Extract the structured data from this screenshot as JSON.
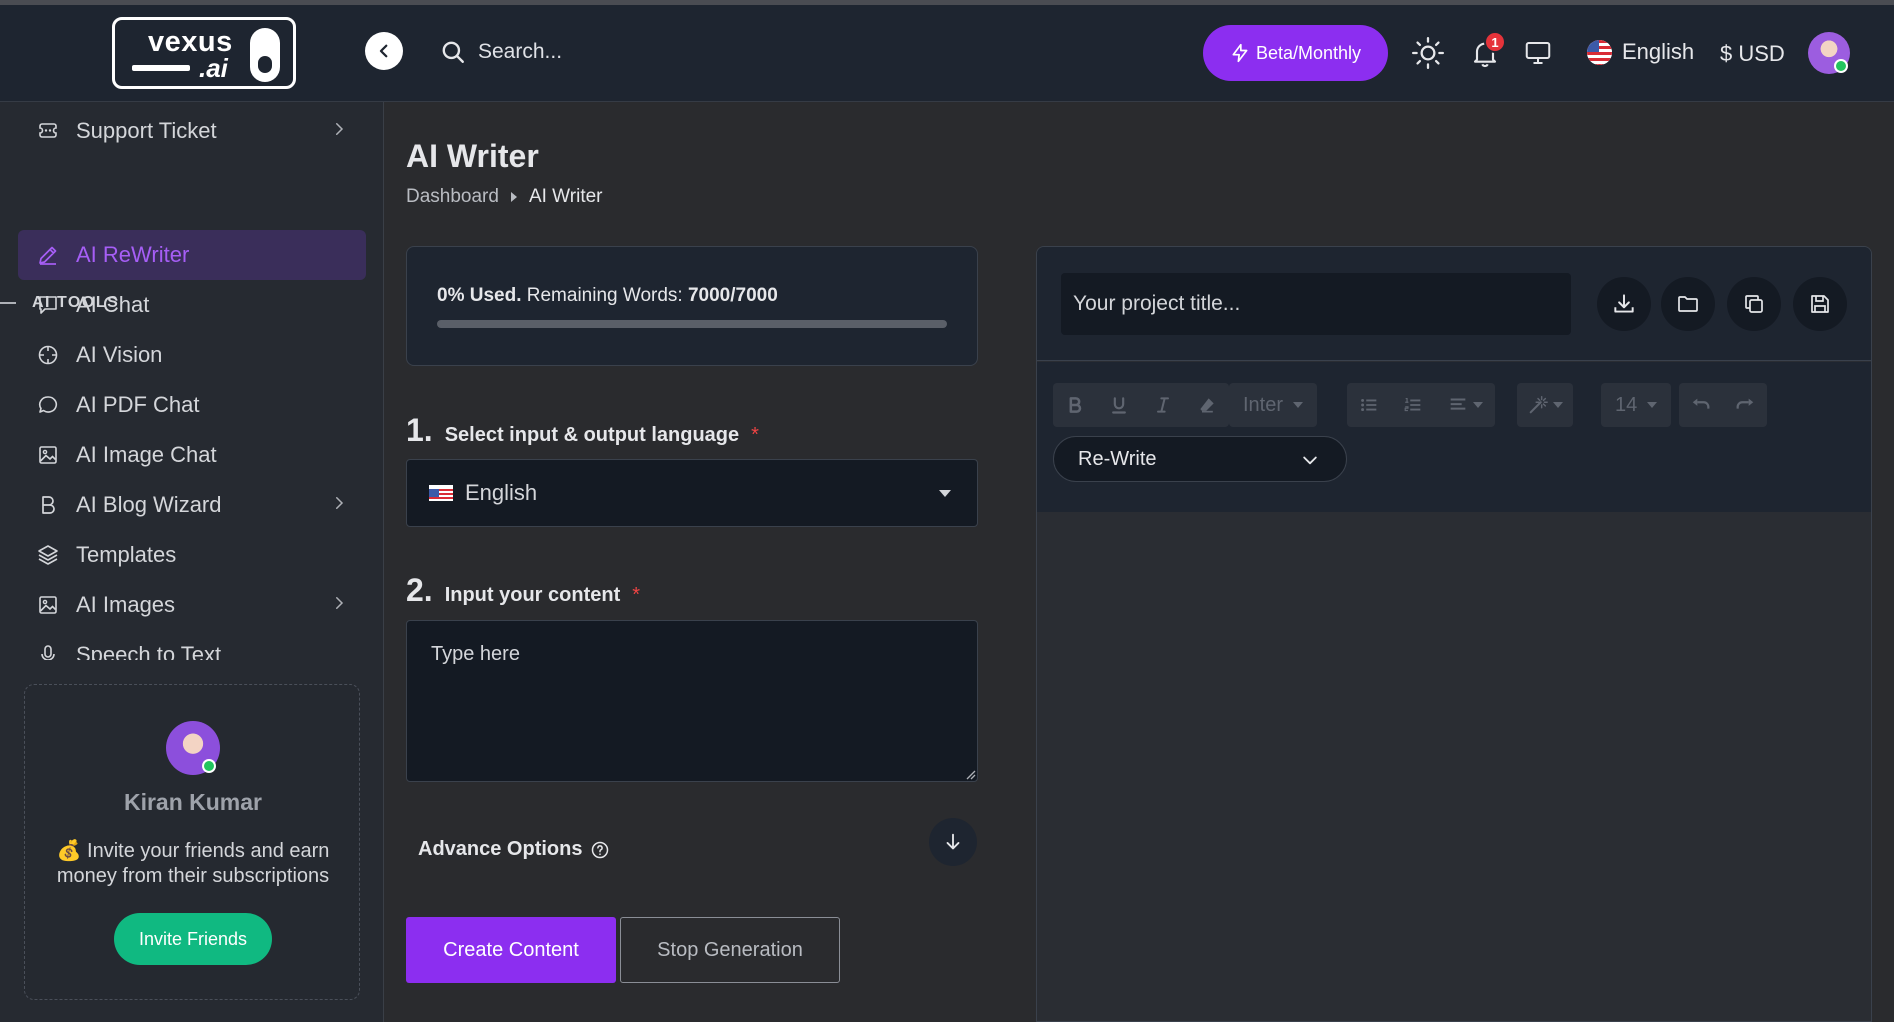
{
  "header": {
    "logo_top": "vexus",
    "logo_bottom": ".ai",
    "search_placeholder": "Search...",
    "plan_label": "Beta/Monthly",
    "notification_count": "1",
    "language": "English",
    "currency": "$ USD"
  },
  "sidebar": {
    "support_ticket": "Support Ticket",
    "section_label": "AI TOOLS",
    "items": [
      {
        "label": "AI ReWriter",
        "icon": "pencil-icon"
      },
      {
        "label": "AI Chat",
        "icon": "chat-square-icon"
      },
      {
        "label": "AI Vision",
        "icon": "vision-icon"
      },
      {
        "label": "AI PDF Chat",
        "icon": "chat-round-icon"
      },
      {
        "label": "AI Image Chat",
        "icon": "image-icon"
      },
      {
        "label": "AI Blog Wizard",
        "icon": "bold-b-icon"
      },
      {
        "label": "Templates",
        "icon": "layers-icon"
      },
      {
        "label": "AI Images",
        "icon": "image-icon"
      },
      {
        "label": "Speech to Text",
        "icon": "mic-icon"
      }
    ],
    "invite": {
      "name": "Kiran Kumar",
      "emoji": "💰",
      "text": "Invite your friends and earn money from their subscriptions",
      "button": "Invite Friends"
    }
  },
  "main": {
    "title": "AI Writer",
    "breadcrumb": [
      "Dashboard",
      "AI Writer"
    ],
    "usage": {
      "percent_label": "0% Used.",
      "remaining_label": "Remaining Words:",
      "remaining_value": "7000/7000",
      "used_fraction": 0
    },
    "step1": {
      "num": "1.",
      "label": "Select input & output language",
      "required": "*"
    },
    "language_value": "English",
    "step2": {
      "num": "2.",
      "label": "Input your content",
      "required": "*"
    },
    "content_placeholder": "Type here",
    "advance_options": "Advance Options",
    "create_button": "Create Content",
    "stop_button": "Stop Generation"
  },
  "editor": {
    "title_placeholder": "Your project title...",
    "font_family": "Inter",
    "font_size": "14",
    "mode": "Re-Write"
  },
  "colors": {
    "accent": "#8c2ef0",
    "success": "#10b981",
    "danger": "#ef4444",
    "header_bg": "#1e2530"
  }
}
